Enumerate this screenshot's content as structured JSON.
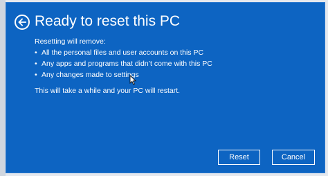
{
  "dialog": {
    "title": "Ready to reset this PC",
    "intro": "Resetting will remove:",
    "items": [
      "All the personal files and user accounts on this PC",
      "Any apps and programs that didn’t come with this PC",
      "Any changes made to settings"
    ],
    "bullet": "•",
    "note": "This will take a while and your PC will restart.",
    "reset_label": "Reset",
    "cancel_label": "Cancel"
  },
  "icons": {
    "back": "back-arrow-icon",
    "cursor": "mouse-pointer-icon"
  },
  "colors": {
    "dialog_background": "#0d64c2",
    "text": "#ffffff"
  }
}
